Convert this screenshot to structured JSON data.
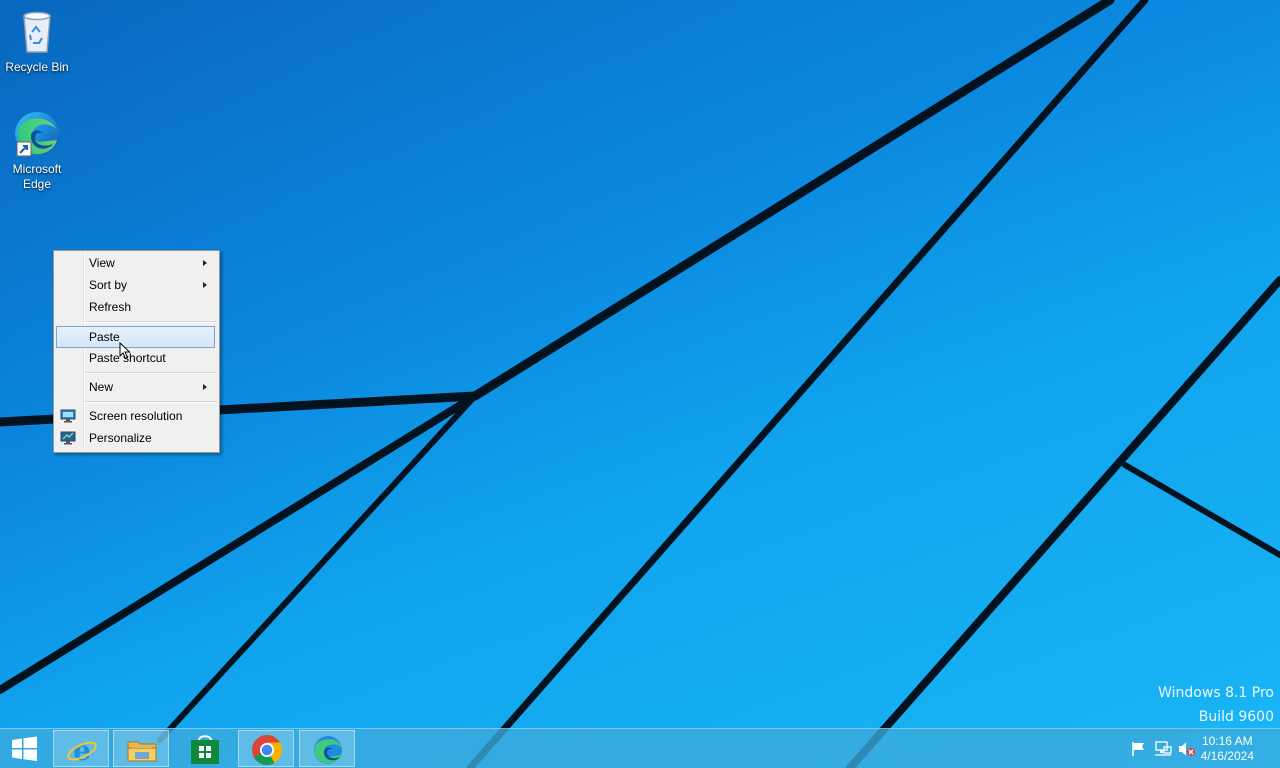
{
  "desktop": {
    "icons": [
      {
        "label": "Recycle Bin",
        "icon": "recycle-bin-icon"
      },
      {
        "label": "Microsoft Edge",
        "label_line1": "Microsoft",
        "label_line2": "Edge",
        "icon": "edge-icon"
      }
    ]
  },
  "context_menu": {
    "items": [
      {
        "label": "View",
        "submenu": true
      },
      {
        "label": "Sort by",
        "submenu": true
      },
      {
        "label": "Refresh",
        "submenu": false
      },
      {
        "label": "Paste",
        "submenu": false,
        "highlighted": true
      },
      {
        "label": "Paste shortcut",
        "submenu": false
      },
      {
        "label": "New",
        "submenu": true
      },
      {
        "label": "Screen resolution",
        "submenu": false,
        "icon": "monitor-icon"
      },
      {
        "label": "Personalize",
        "submenu": false,
        "icon": "personalize-icon"
      }
    ]
  },
  "watermark": {
    "line1": "Windows 8.1 Pro",
    "line2": "Build 9600"
  },
  "taskbar": {
    "pinned": [
      {
        "name": "Internet Explorer",
        "icon": "internet-explorer-icon"
      },
      {
        "name": "File Explorer",
        "icon": "file-explorer-icon"
      },
      {
        "name": "Store",
        "icon": "store-icon"
      },
      {
        "name": "Google Chrome",
        "icon": "chrome-icon"
      },
      {
        "name": "Microsoft Edge",
        "icon": "edge-icon"
      }
    ],
    "tray": {
      "icons": [
        "action-center-flag-icon",
        "network-icon",
        "volume-muted-icon"
      ],
      "time": "10:16 AM",
      "date": "4/16/2024"
    }
  },
  "colors": {
    "accent_highlight": "#d5e6f8",
    "taskbar": "#3caadc",
    "wallpaper": "#0b88df"
  }
}
